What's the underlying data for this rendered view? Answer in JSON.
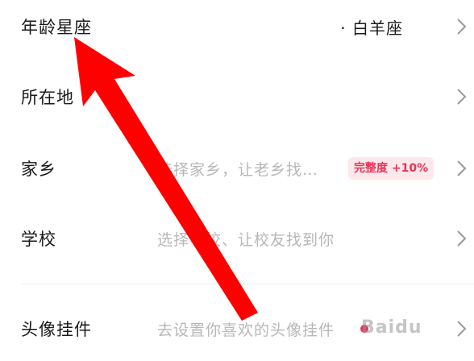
{
  "rows": [
    {
      "label": "年龄星座",
      "value": "· 白羊座",
      "hint": ""
    },
    {
      "label": "所在地",
      "value": "",
      "hint": ""
    },
    {
      "label": "家乡",
      "value": "",
      "hint": "选择家乡，让老乡找…",
      "badge": "完整度 +10%"
    },
    {
      "label": "学校",
      "value": "",
      "hint": "选择学校、让校友找到你"
    },
    {
      "label": "头像挂件",
      "value": "",
      "hint": "去设置你喜欢的头像挂件"
    }
  ],
  "watermark": "Baidu",
  "icons": {
    "chevron": "chevron-right-icon",
    "arrow": "red-arrow-annotation"
  },
  "colors": {
    "accent": "#e8345a",
    "badge_bg": "#fde8ec",
    "arrow": "#ff0000"
  }
}
